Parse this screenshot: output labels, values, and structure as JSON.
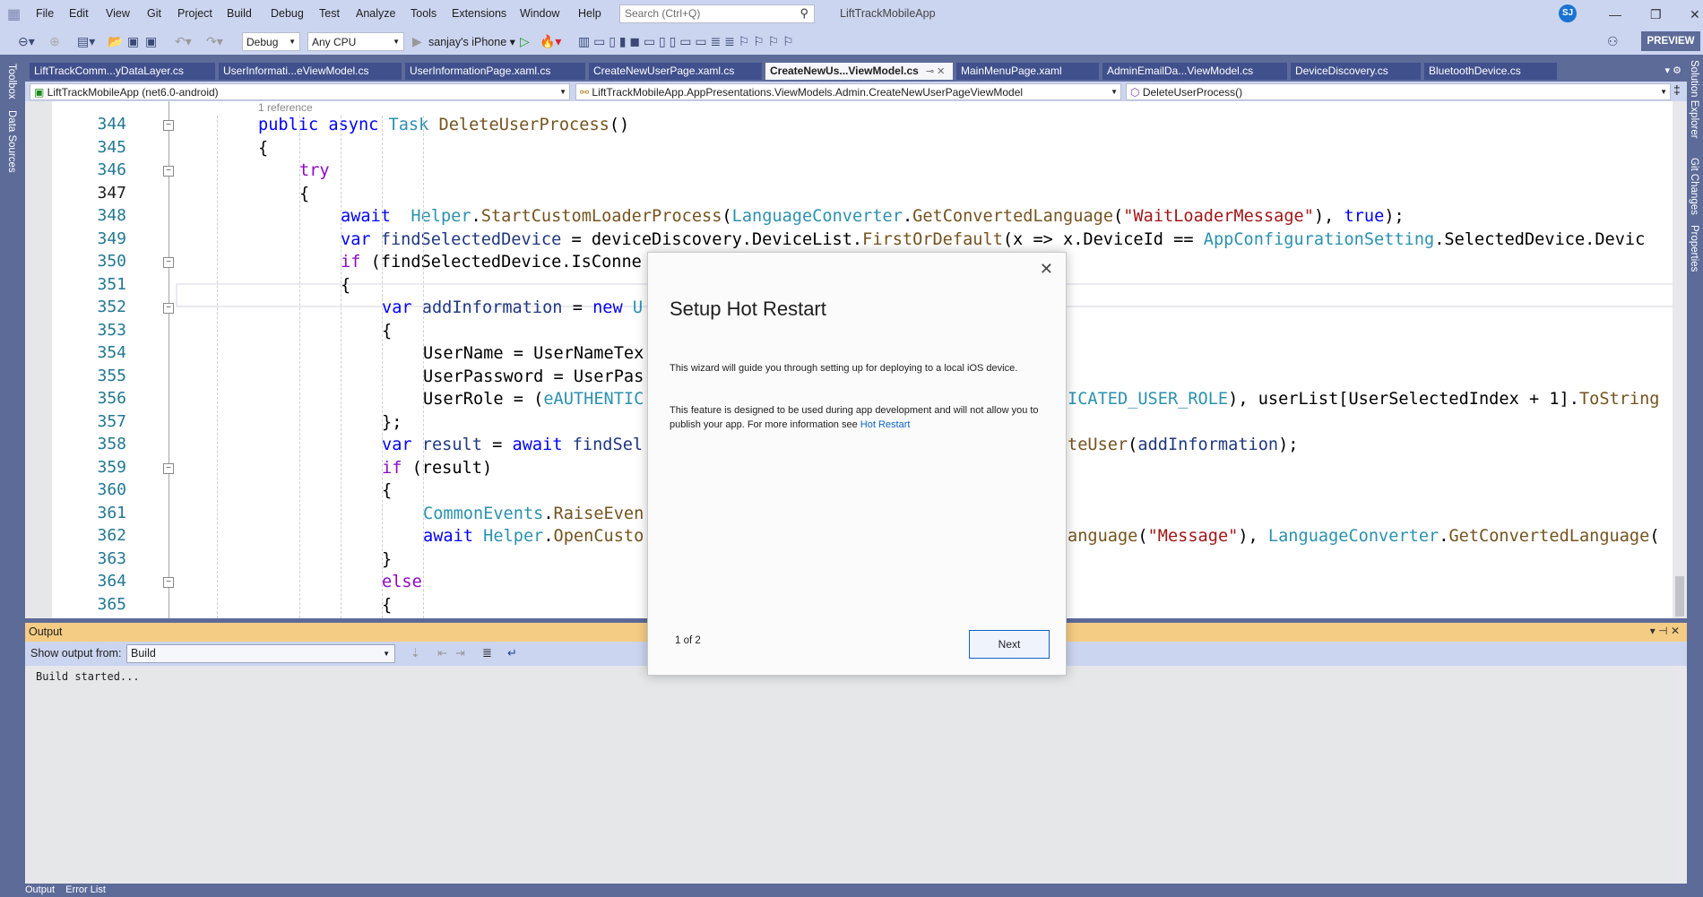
{
  "titlebar": {
    "menu": [
      "File",
      "Edit",
      "View",
      "Git",
      "Project",
      "Build",
      "Debug",
      "Test",
      "Analyze",
      "Tools",
      "Extensions",
      "Window",
      "Help"
    ],
    "search_placeholder": "Search (Ctrl+Q)",
    "app_title": "LiftTrackMobileApp",
    "avatar_initials": "SJ"
  },
  "toolbar": {
    "config": "Debug",
    "platform": "Any CPU",
    "device": "sanjay's iPhone",
    "preview_label": "PREVIEW"
  },
  "side": {
    "left": [
      "Toolbox",
      "Data Sources"
    ],
    "right": [
      "Solution Explorer",
      "Git Changes",
      "Properties"
    ]
  },
  "tabs": [
    {
      "label": "LiftTrackComm...yDataLayer.cs",
      "active": false
    },
    {
      "label": "UserInformati...eViewModel.cs",
      "active": false
    },
    {
      "label": "UserInformationPage.xaml.cs",
      "active": false
    },
    {
      "label": "CreateNewUserPage.xaml.cs",
      "active": false
    },
    {
      "label": "CreateNewUs...ViewModel.cs",
      "active": true
    },
    {
      "label": "MainMenuPage.xaml",
      "active": false
    },
    {
      "label": "AdminEmailDa...ViewModel.cs",
      "active": false
    },
    {
      "label": "DeviceDiscovery.cs",
      "active": false
    },
    {
      "label": "BluetoothDevice.cs",
      "active": false
    }
  ],
  "navbar": {
    "project": "LiftTrackMobileApp (net6.0-android)",
    "class": "LiftTrackMobileApp.AppPresentations.ViewModels.Admin.CreateNewUserPageViewModel",
    "member": "DeleteUserProcess()"
  },
  "editor": {
    "codelens": "1 reference",
    "current_line": 347,
    "lines": [
      {
        "num": 344,
        "fold": true,
        "indent": 0,
        "tokens": [
          [
            "public ",
            "kw"
          ],
          [
            "async ",
            "kw"
          ],
          [
            "Task ",
            "typ"
          ],
          [
            "DeleteUserProcess",
            "mth"
          ],
          [
            "()",
            "def"
          ]
        ]
      },
      {
        "num": 345,
        "fold": false,
        "indent": 0,
        "tokens": [
          [
            "{",
            "def"
          ]
        ]
      },
      {
        "num": 346,
        "fold": true,
        "indent": 1,
        "tokens": [
          [
            "try",
            "ctl"
          ]
        ]
      },
      {
        "num": 347,
        "fold": false,
        "indent": 1,
        "tokens": [
          [
            "{",
            "def"
          ]
        ]
      },
      {
        "num": 348,
        "fold": false,
        "indent": 2,
        "tokens": [
          [
            "await  ",
            "kw"
          ],
          [
            "Helper",
            "typ"
          ],
          [
            ".",
            "def"
          ],
          [
            "StartCustomLoaderProcess",
            "mth"
          ],
          [
            "(",
            "def"
          ],
          [
            "LanguageConverter",
            "typ"
          ],
          [
            ".",
            "def"
          ],
          [
            "GetConvertedLanguage",
            "mth"
          ],
          [
            "(",
            "def"
          ],
          [
            "\"WaitLoaderMessage\"",
            "str"
          ],
          [
            "), ",
            "def"
          ],
          [
            "true",
            "kw"
          ],
          [
            ");",
            "def"
          ]
        ]
      },
      {
        "num": 349,
        "fold": false,
        "indent": 2,
        "tokens": [
          [
            "var ",
            "kw"
          ],
          [
            "findSelectedDevice",
            "loc"
          ],
          [
            " = deviceDiscovery.DeviceList.",
            "def"
          ],
          [
            "FirstOrDefault",
            "mth"
          ],
          [
            "(x => x.DeviceId == ",
            "def"
          ],
          [
            "AppConfigurationSetting",
            "typ"
          ],
          [
            ".SelectedDevice.Devic",
            "def"
          ]
        ]
      },
      {
        "num": 350,
        "fold": true,
        "indent": 2,
        "tokens": [
          [
            "if ",
            "ctl"
          ],
          [
            "(findSelectedDevice.IsConne",
            "def"
          ]
        ]
      },
      {
        "num": 351,
        "fold": false,
        "indent": 2,
        "tokens": [
          [
            "{",
            "def"
          ]
        ]
      },
      {
        "num": 352,
        "fold": true,
        "indent": 3,
        "tokens": [
          [
            "var ",
            "kw"
          ],
          [
            "addInformation",
            "loc"
          ],
          [
            " = ",
            "def"
          ],
          [
            "new ",
            "kw"
          ],
          [
            "U",
            "typ"
          ]
        ]
      },
      {
        "num": 353,
        "fold": false,
        "indent": 3,
        "tokens": [
          [
            "{",
            "def"
          ]
        ]
      },
      {
        "num": 354,
        "fold": false,
        "indent": 4,
        "tokens": [
          [
            "UserName = UserNameTex",
            "def"
          ]
        ]
      },
      {
        "num": 355,
        "fold": false,
        "indent": 4,
        "tokens": [
          [
            "UserPassword = UserPas",
            "def"
          ]
        ]
      },
      {
        "num": 356,
        "fold": false,
        "indent": 4,
        "tokens": [
          [
            "UserRole = (",
            "def"
          ],
          [
            "eAUTHENTIC",
            "typ"
          ]
        ],
        "right": [
          [
            "ICATED_USER_ROLE",
            "typ"
          ],
          [
            "), userList[UserSelectedIndex + 1].",
            "def"
          ],
          [
            "ToString",
            "mth"
          ]
        ]
      },
      {
        "num": 357,
        "fold": false,
        "indent": 3,
        "tokens": [
          [
            "};",
            "def"
          ]
        ]
      },
      {
        "num": 358,
        "fold": false,
        "indent": 3,
        "tokens": [
          [
            "var ",
            "kw"
          ],
          [
            "result",
            "loc"
          ],
          [
            " = ",
            "def"
          ],
          [
            "await ",
            "kw"
          ],
          [
            "findSel",
            "loc"
          ]
        ],
        "right": [
          [
            "teUser",
            "mth"
          ],
          [
            "(",
            "def"
          ],
          [
            "addInformation",
            "loc"
          ],
          [
            ");",
            "def"
          ]
        ]
      },
      {
        "num": 359,
        "fold": true,
        "indent": 3,
        "tokens": [
          [
            "if ",
            "ctl"
          ],
          [
            "(result)",
            "def"
          ]
        ]
      },
      {
        "num": 360,
        "fold": false,
        "indent": 3,
        "tokens": [
          [
            "{",
            "def"
          ]
        ]
      },
      {
        "num": 361,
        "fold": false,
        "indent": 4,
        "tokens": [
          [
            "CommonEvents",
            "typ"
          ],
          [
            ".",
            "def"
          ],
          [
            "RaiseEven",
            "mth"
          ]
        ]
      },
      {
        "num": 362,
        "fold": false,
        "indent": 4,
        "tokens": [
          [
            "await ",
            "kw"
          ],
          [
            "Helper",
            "typ"
          ],
          [
            ".",
            "def"
          ],
          [
            "OpenCusto",
            "mth"
          ]
        ],
        "right": [
          [
            "anguage",
            "mth"
          ],
          [
            "(",
            "def"
          ],
          [
            "\"Message\"",
            "str"
          ],
          [
            "), ",
            "def"
          ],
          [
            "LanguageConverter",
            "typ"
          ],
          [
            ".",
            "def"
          ],
          [
            "GetConvertedLanguage",
            "mth"
          ],
          [
            "(",
            "def"
          ]
        ]
      },
      {
        "num": 363,
        "fold": false,
        "indent": 3,
        "tokens": [
          [
            "}",
            "def"
          ]
        ]
      },
      {
        "num": 364,
        "fold": true,
        "indent": 3,
        "tokens": [
          [
            "else",
            "ctl"
          ]
        ]
      },
      {
        "num": 365,
        "fold": false,
        "indent": 3,
        "tokens": [
          [
            "{",
            "def"
          ]
        ]
      }
    ]
  },
  "output": {
    "title": "Output",
    "show_from_label": "Show output from:",
    "source": "Build",
    "text": "Build started...",
    "bottom_tabs": [
      "Output",
      "Error List"
    ]
  },
  "dialog": {
    "title": "Setup Hot Restart",
    "para1": "This wizard will guide you through setting up for deploying to a local iOS device.",
    "para2": "This feature is designed to be used during app development and will not allow you to publish your app. For more information see ",
    "link": "Hot Restart",
    "page": "1 of 2",
    "next_label": "Next"
  },
  "colors": {
    "accent": "#5d6b99",
    "chrome": "#ccd5f0",
    "output_header": "#f5cc84",
    "link": "#0e63c7"
  }
}
